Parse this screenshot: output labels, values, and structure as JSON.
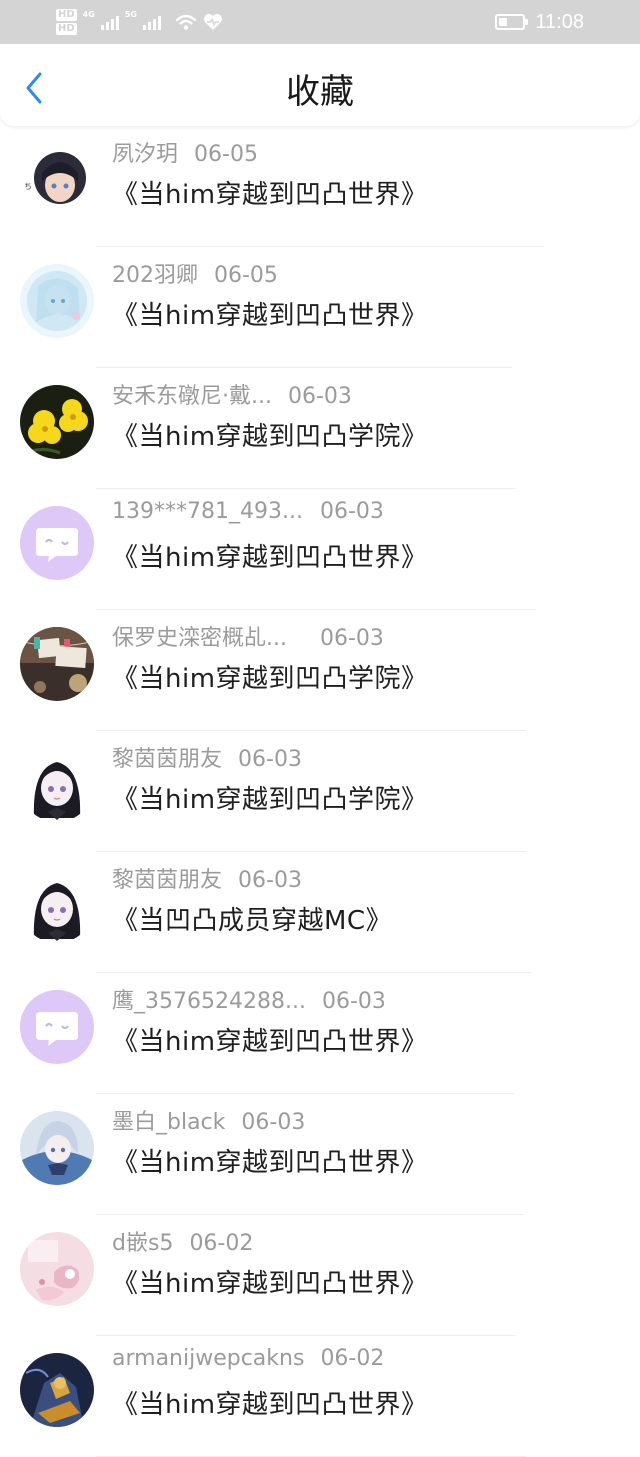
{
  "status_bar": {
    "hd_top": "HD",
    "hd_bottom": "HD",
    "net1": "4G",
    "net2": "5G",
    "time": "11:08",
    "battery_level": 0.35,
    "icons": [
      "hd-icon",
      "signal-icon",
      "wifi-icon",
      "heart-icon",
      "battery-icon"
    ]
  },
  "header": {
    "title": "收藏",
    "back_icon": "chevron-left-icon",
    "accent_color": "#2c8bec"
  },
  "favorites": [
    {
      "user": "夙汐玥",
      "date": "06-05",
      "title": "《当him穿越到凹凸世界》"
    },
    {
      "user": "202羽卿",
      "date": "06-05",
      "title": "《当him穿越到凹凸世界》"
    },
    {
      "user": "安禾东礅尼·戴...",
      "date": "06-03",
      "title": "《当him穿越到凹凸学院》"
    },
    {
      "user": "139***781_493...",
      "date": "06-03",
      "title": "《当him穿越到凹凸世界》"
    },
    {
      "user": "保罗史滦密概乩...",
      "date": "06-03",
      "title": "《当him穿越到凹凸学院》"
    },
    {
      "user": "黎茵茵朋友",
      "date": "06-03",
      "title": "《当him穿越到凹凸学院》"
    },
    {
      "user": "黎茵茵朋友",
      "date": "06-03",
      "title": "《当凹凸成员穿越MC》"
    },
    {
      "user": "鹰_3576524288...",
      "date": "06-03",
      "title": "《当him穿越到凹凸世界》"
    },
    {
      "user": "墨白_black",
      "date": "06-03",
      "title": "《当him穿越到凹凸世界》"
    },
    {
      "user": "d嵌s5",
      "date": "06-02",
      "title": "《当him穿越到凹凸世界》"
    },
    {
      "user": "armanijwepcakns",
      "date": "06-02",
      "title": "《当him穿越到凹凸世界》"
    }
  ]
}
